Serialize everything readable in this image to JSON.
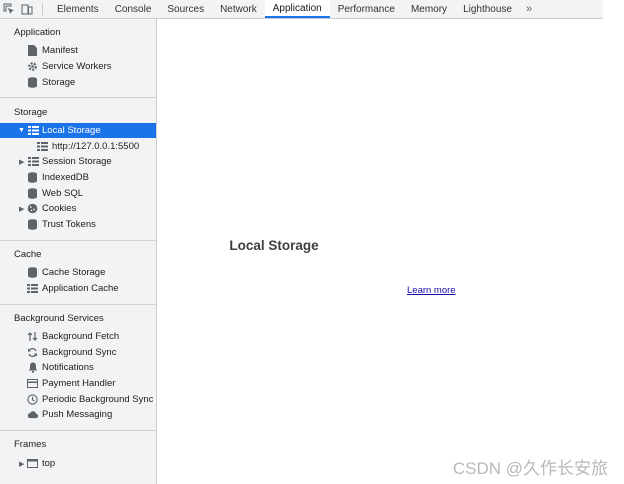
{
  "tabs": [
    "Elements",
    "Console",
    "Sources",
    "Network",
    "Application",
    "Performance",
    "Memory",
    "Lighthouse"
  ],
  "active_tab": "Application",
  "more_glyph": "»",
  "sidebar": {
    "application": {
      "title": "Application",
      "items": [
        {
          "label": "Manifest",
          "icon": "file-icon"
        },
        {
          "label": "Service Workers",
          "icon": "gear-icon"
        },
        {
          "label": "Storage",
          "icon": "database-icon"
        }
      ]
    },
    "storage": {
      "title": "Storage",
      "local_storage": "Local Storage",
      "local_origin": "http://127.0.0.1:5500",
      "session_storage": "Session Storage",
      "indexeddb": "IndexedDB",
      "websql": "Web SQL",
      "cookies": "Cookies",
      "trust_tokens": "Trust Tokens"
    },
    "cache": {
      "title": "Cache",
      "cache_storage": "Cache Storage",
      "application_cache": "Application Cache"
    },
    "background": {
      "title": "Background Services",
      "items": [
        {
          "label": "Background Fetch",
          "icon": "fetch-arrows-icon"
        },
        {
          "label": "Background Sync",
          "icon": "sync-icon"
        },
        {
          "label": "Notifications",
          "icon": "bell-icon"
        },
        {
          "label": "Payment Handler",
          "icon": "card-icon"
        },
        {
          "label": "Periodic Background Sync",
          "icon": "clock-icon"
        },
        {
          "label": "Push Messaging",
          "icon": "cloud-icon"
        }
      ]
    },
    "frames": {
      "title": "Frames",
      "top": "top"
    }
  },
  "main": {
    "title": "Local Storage",
    "learn_more": "Learn more"
  },
  "watermark": "CSDN @久作长安旅",
  "colors": {
    "selected": "#1a73e8",
    "sidebar_bg": "#f1f3f4",
    "link": "#1a0dab"
  }
}
